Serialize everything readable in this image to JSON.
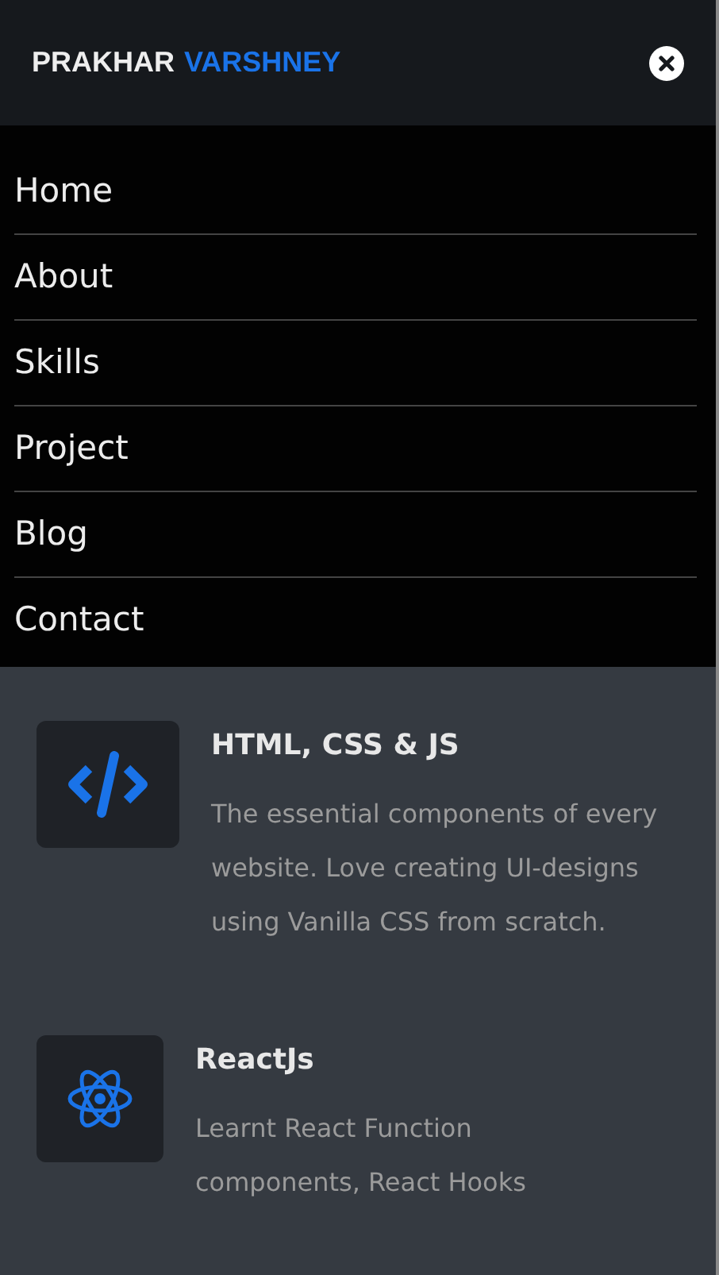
{
  "header": {
    "brand_first": "PRAKHAR",
    "brand_second": "VARSHNEY"
  },
  "menu": {
    "open": true,
    "items": [
      {
        "label": "Home"
      },
      {
        "label": "About"
      },
      {
        "label": "Skills"
      },
      {
        "label": "Project"
      },
      {
        "label": "Blog"
      },
      {
        "label": "Contact"
      }
    ]
  },
  "services": [
    {
      "kind": "code",
      "title": "HTML, CSS & JS",
      "description": "The essential components of every website. Love creating UI-designs using Vanilla CSS from scratch."
    },
    {
      "kind": "react",
      "title": "ReactJs",
      "description": "Learnt React Function components, React Hooks"
    }
  ]
}
